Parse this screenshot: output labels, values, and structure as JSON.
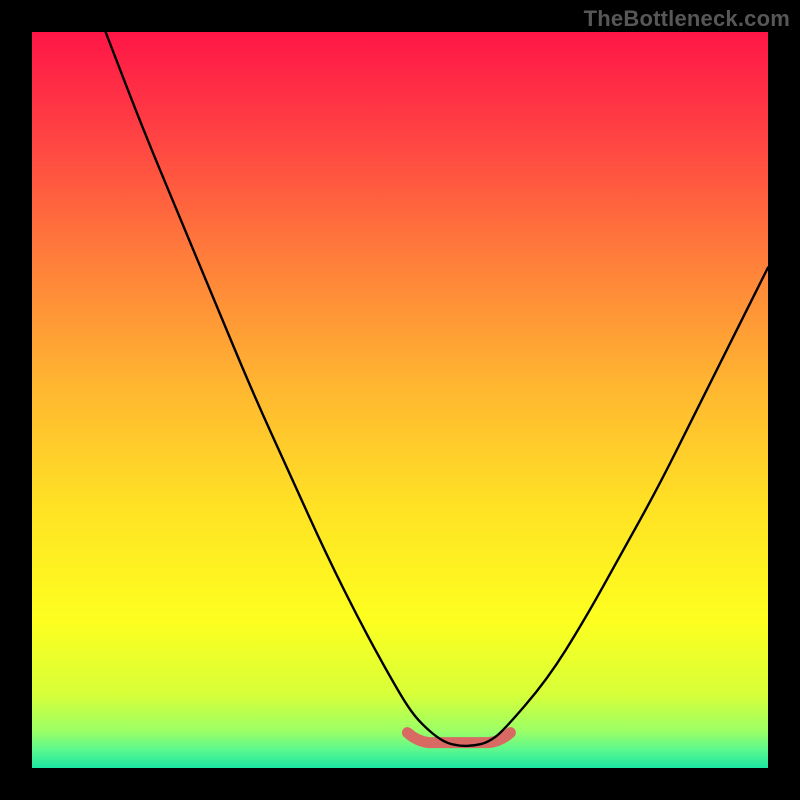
{
  "watermark": "TheBottleneck.com",
  "colors": {
    "frame": "#000000",
    "curve": "#000000",
    "bump": "#d96a63",
    "gradient_stops": [
      {
        "offset": 0.0,
        "color": "#ff1647"
      },
      {
        "offset": 0.12,
        "color": "#ff3b44"
      },
      {
        "offset": 0.3,
        "color": "#ff7b3b"
      },
      {
        "offset": 0.48,
        "color": "#ffb631"
      },
      {
        "offset": 0.65,
        "color": "#ffe324"
      },
      {
        "offset": 0.8,
        "color": "#fdff1f"
      },
      {
        "offset": 0.9,
        "color": "#d7ff38"
      },
      {
        "offset": 0.95,
        "color": "#9bff66"
      },
      {
        "offset": 0.975,
        "color": "#5cf88e"
      },
      {
        "offset": 1.0,
        "color": "#1be7a0"
      }
    ]
  },
  "chart_data": {
    "type": "line",
    "title": "",
    "xlabel": "",
    "ylabel": "",
    "xlim": [
      0,
      100
    ],
    "ylim": [
      0,
      100
    ],
    "series": [
      {
        "name": "bottleneck-curve",
        "x": [
          10,
          15,
          20,
          25,
          30,
          35,
          40,
          45,
          50,
          52,
          54,
          56,
          58,
          60,
          62,
          64,
          70,
          75,
          80,
          85,
          90,
          95,
          100
        ],
        "y": [
          100,
          87,
          75,
          63,
          51,
          40,
          29,
          19,
          10,
          7,
          5,
          3.5,
          3,
          3,
          3.5,
          5,
          12,
          20,
          29,
          38,
          48,
          58,
          68
        ]
      }
    ],
    "annotations": [
      {
        "name": "optimal-zone-marker",
        "type": "bump",
        "x_range": [
          51,
          65
        ],
        "y": 4
      }
    ]
  }
}
